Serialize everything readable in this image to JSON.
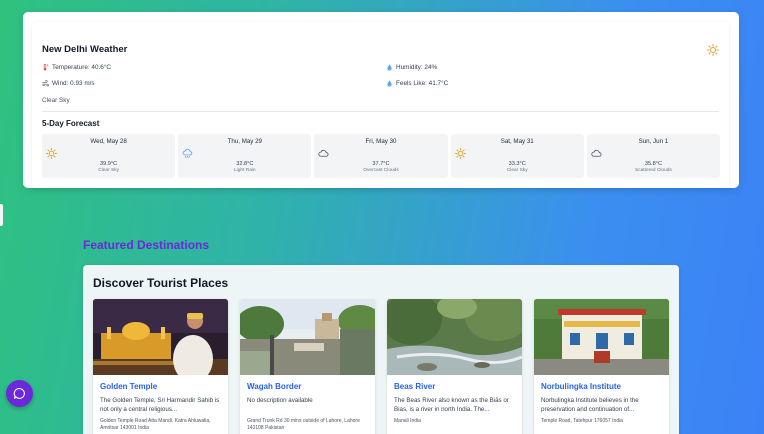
{
  "weather": {
    "title": "New Delhi Weather",
    "temperature": "Temperature: 40.6°C",
    "humidity": "Humidity: 24%",
    "wind": "Wind: 0.93 m/s",
    "feels_like": "Feels Like: 41.7°C",
    "condition": "Clear Sky",
    "icons": {
      "main": "sun-icon",
      "temperature": "thermometer-icon",
      "humidity": "droplet-icon",
      "wind": "wind-icon",
      "feels_like": "droplet-icon"
    },
    "colors": {
      "sun": "#e0a22a",
      "thermometer": "#ef4444",
      "droplet": "#60a5fa"
    }
  },
  "forecast": {
    "title": "5-Day Forecast",
    "days": [
      {
        "date": "Wed, May 28",
        "temp": "39.9°C",
        "condition": "Clear Sky",
        "icon": "sun-icon"
      },
      {
        "date": "Thu, May 29",
        "temp": "32.8°C",
        "condition": "Light Rain",
        "icon": "rain-cloud-icon"
      },
      {
        "date": "Fri, May 30",
        "temp": "37.7°C",
        "condition": "Overcast Clouds",
        "icon": "cloud-icon"
      },
      {
        "date": "Sat, May 31",
        "temp": "33.3°C",
        "condition": "Clear Sky",
        "icon": "sun-icon"
      },
      {
        "date": "Sun, Jun 1",
        "temp": "35.8°C",
        "condition": "Scattered Clouds",
        "icon": "cloud-icon"
      }
    ]
  },
  "featured": {
    "heading": "Featured Destinations",
    "card_title": "Discover Tourist Places",
    "places": [
      {
        "name": "Golden Temple",
        "description": "The Golden Temple, Sri Harmandir Sahib is not only a central religious...",
        "address": "Golden Temple Road Atta Mandi, Katra Ahluwalia, Amritsar 143001 India"
      },
      {
        "name": "Wagah Border",
        "description": "No description available",
        "address": "Grand Trunk Rd 30 mins outside of Lahore, Lahore 143108 Pakistan"
      },
      {
        "name": "Beas River",
        "description": "The Beas River also known as the Biās or Bias, is a river in north India. The...",
        "address": "Manali India"
      },
      {
        "name": "Norbulingka Institute",
        "description": "Norbulingka Institute believes in the preservation and continuation of...",
        "address": "Temple Road, Tatehpur 176057 India"
      }
    ]
  },
  "chat": {
    "icon": "chat-icon",
    "color": "#6d28d9"
  },
  "theme": {
    "accent": "#6d28d9",
    "link": "#2563eb"
  }
}
